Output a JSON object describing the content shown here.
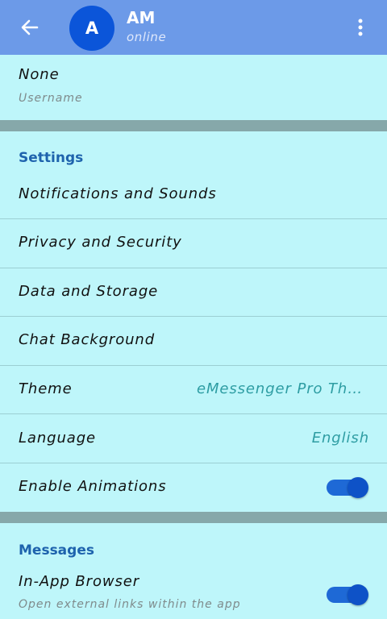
{
  "header": {
    "avatar_letter": "A",
    "title": "AM",
    "status": "online"
  },
  "profile": {
    "username_value": "None",
    "username_label": "Username"
  },
  "settings": {
    "section_title": "Settings",
    "items": [
      {
        "label": "Notifications and Sounds"
      },
      {
        "label": "Privacy and Security"
      },
      {
        "label": "Data and Storage"
      },
      {
        "label": "Chat Background"
      },
      {
        "label": "Theme",
        "value": "eMessenger Pro Theme"
      },
      {
        "label": "Language",
        "value": "English"
      },
      {
        "label": "Enable Animations",
        "toggle": true
      }
    ]
  },
  "messages": {
    "section_title": "Messages",
    "in_app_browser": {
      "label": "In-App Browser",
      "description": "Open external links within the app",
      "toggle": true
    }
  },
  "colors": {
    "header_bg": "#6c9ae8",
    "page_bg": "#bef6fa",
    "accent": "#1e63ad",
    "toggle_on": "#1e69d6"
  },
  "icons": [
    "back-arrow-icon",
    "more-vertical-icon"
  ]
}
